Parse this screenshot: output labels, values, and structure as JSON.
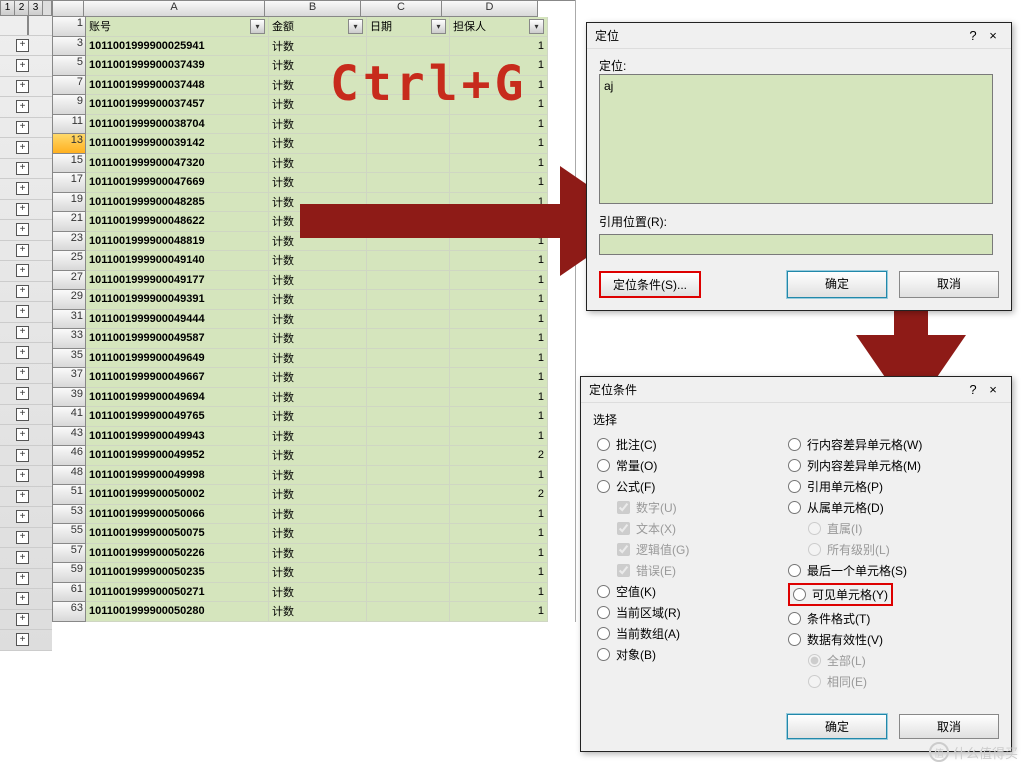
{
  "outline_levels": [
    "1",
    "2",
    "3"
  ],
  "col_headers": {
    "A": "A",
    "B": "B",
    "C": "C",
    "D": "D"
  },
  "header_row": {
    "num": "1",
    "A": "账号",
    "B": "金额",
    "C": "日期",
    "D": "担保人"
  },
  "rows": [
    {
      "num": "3",
      "A": "1011001999900025941",
      "B": "计数",
      "D": "1"
    },
    {
      "num": "5",
      "A": "1011001999900037439",
      "B": "计数",
      "D": "1"
    },
    {
      "num": "7",
      "A": "1011001999900037448",
      "B": "计数",
      "D": "1"
    },
    {
      "num": "9",
      "A": "1011001999900037457",
      "B": "计数",
      "D": "1"
    },
    {
      "num": "11",
      "A": "1011001999900038704",
      "B": "计数",
      "D": "1"
    },
    {
      "num": "13",
      "A": "1011001999900039142",
      "B": "计数",
      "D": "1",
      "sel": true
    },
    {
      "num": "15",
      "A": "1011001999900047320",
      "B": "计数",
      "D": "1"
    },
    {
      "num": "17",
      "A": "1011001999900047669",
      "B": "计数",
      "D": "1"
    },
    {
      "num": "19",
      "A": "1011001999900048285",
      "B": "计数",
      "D": "1"
    },
    {
      "num": "21",
      "A": "1011001999900048622",
      "B": "计数",
      "D": "1"
    },
    {
      "num": "23",
      "A": "1011001999900048819",
      "B": "计数",
      "D": "1"
    },
    {
      "num": "25",
      "A": "1011001999900049140",
      "B": "计数",
      "D": "1"
    },
    {
      "num": "27",
      "A": "1011001999900049177",
      "B": "计数",
      "D": "1"
    },
    {
      "num": "29",
      "A": "1011001999900049391",
      "B": "计数",
      "D": "1"
    },
    {
      "num": "31",
      "A": "1011001999900049444",
      "B": "计数",
      "D": "1"
    },
    {
      "num": "33",
      "A": "1011001999900049587",
      "B": "计数",
      "D": "1"
    },
    {
      "num": "35",
      "A": "1011001999900049649",
      "B": "计数",
      "D": "1"
    },
    {
      "num": "37",
      "A": "1011001999900049667",
      "B": "计数",
      "D": "1"
    },
    {
      "num": "39",
      "A": "1011001999900049694",
      "B": "计数",
      "D": "1"
    },
    {
      "num": "41",
      "A": "1011001999900049765",
      "B": "计数",
      "D": "1"
    },
    {
      "num": "43",
      "A": "1011001999900049943",
      "B": "计数",
      "D": "1"
    },
    {
      "num": "46",
      "A": "1011001999900049952",
      "B": "计数",
      "D": "2"
    },
    {
      "num": "48",
      "A": "1011001999900049998",
      "B": "计数",
      "D": "1"
    },
    {
      "num": "51",
      "A": "1011001999900050002",
      "B": "计数",
      "D": "2"
    },
    {
      "num": "53",
      "A": "1011001999900050066",
      "B": "计数",
      "D": "1"
    },
    {
      "num": "55",
      "A": "1011001999900050075",
      "B": "计数",
      "D": "1"
    },
    {
      "num": "57",
      "A": "1011001999900050226",
      "B": "计数",
      "D": "1"
    },
    {
      "num": "59",
      "A": "1011001999900050235",
      "B": "计数",
      "D": "1"
    },
    {
      "num": "61",
      "A": "1011001999900050271",
      "B": "计数",
      "D": "1"
    },
    {
      "num": "63",
      "A": "1011001999900050280",
      "B": "计数",
      "D": "1"
    }
  ],
  "annotation": "Ctrl+G",
  "goto_dlg": {
    "title": "定位",
    "help": "?",
    "close": "×",
    "label": "定位:",
    "value": "aj",
    "ref_label": "引用位置(R):",
    "ref_value": "",
    "special_btn": "定位条件(S)...",
    "ok": "确定",
    "cancel": "取消"
  },
  "cond_dlg": {
    "title": "定位条件",
    "help": "?",
    "close": "×",
    "section": "选择",
    "opts_left": [
      {
        "label": "批注(C)"
      },
      {
        "label": "常量(O)"
      },
      {
        "label": "公式(F)"
      },
      {
        "label": "数字(U)",
        "check": true,
        "indent": true,
        "disabled": true,
        "checked": true
      },
      {
        "label": "文本(X)",
        "check": true,
        "indent": true,
        "disabled": true,
        "checked": true
      },
      {
        "label": "逻辑值(G)",
        "check": true,
        "indent": true,
        "disabled": true,
        "checked": true
      },
      {
        "label": "错误(E)",
        "check": true,
        "indent": true,
        "disabled": true,
        "checked": true
      },
      {
        "label": "空值(K)"
      },
      {
        "label": "当前区域(R)"
      },
      {
        "label": "当前数组(A)"
      },
      {
        "label": "对象(B)"
      }
    ],
    "opts_right": [
      {
        "label": "行内容差异单元格(W)"
      },
      {
        "label": "列内容差异单元格(M)"
      },
      {
        "label": "引用单元格(P)"
      },
      {
        "label": "从属单元格(D)"
      },
      {
        "label": "直属(I)",
        "indent": true,
        "disabled": true,
        "checked": true
      },
      {
        "label": "所有级别(L)",
        "indent": true,
        "disabled": true
      },
      {
        "label": "最后一个单元格(S)"
      },
      {
        "label": "可见单元格(Y)",
        "checked": true,
        "highlight": true
      },
      {
        "label": "条件格式(T)"
      },
      {
        "label": "数据有效性(V)"
      },
      {
        "label": "全部(L)",
        "indent": true,
        "disabled": true,
        "checked": true
      },
      {
        "label": "相同(E)",
        "indent": true,
        "disabled": true
      }
    ],
    "ok": "确定",
    "cancel": "取消"
  },
  "watermark": "什么值得买"
}
